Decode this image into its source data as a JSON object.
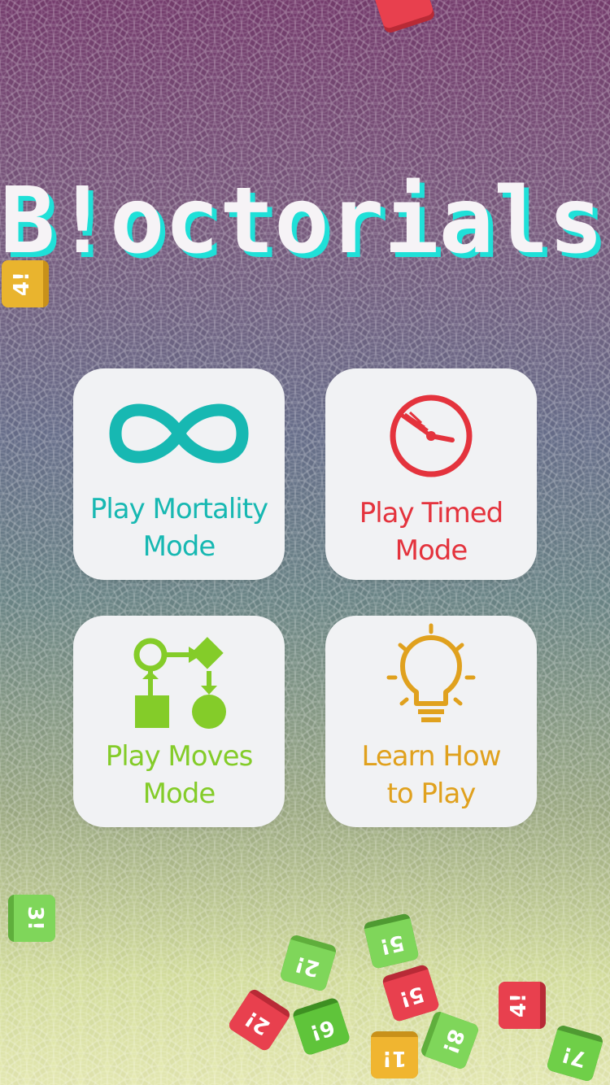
{
  "app": {
    "title": "B!octorials"
  },
  "colors": {
    "title_fill": "#f6f3f6",
    "title_shadow": "#1fe0d8",
    "card_bg": "#f1f2f4",
    "mortality": "#17b8b2",
    "timed": "#e4333d",
    "moves": "#84cc29",
    "learn": "#e0a11e"
  },
  "menu": {
    "mortality": {
      "line1": "Play Mortality",
      "line2": "Mode",
      "icon": "infinity-icon"
    },
    "timed": {
      "line1": "Play Timed",
      "line2": "Mode",
      "icon": "stopwatch-icon"
    },
    "moves": {
      "line1": "Play Moves",
      "line2": "Mode",
      "icon": "flowchart-icon"
    },
    "learn": {
      "line1": "Learn How",
      "line2": "to Play",
      "icon": "lightbulb-icon"
    }
  },
  "blocks": [
    {
      "label": "4!",
      "color": "#e9b42e",
      "shade": "#c8911a"
    },
    {
      "label": "3!",
      "color": "#7fd65a",
      "shade": "#5fae3c"
    },
    {
      "label": "2!",
      "color": "#7fd65a",
      "shade": "#5fae3c"
    },
    {
      "label": "5!",
      "color": "#7fd65a",
      "shade": "#4f9a32"
    },
    {
      "label": "2!",
      "color": "#e8404e",
      "shade": "#b82a36"
    },
    {
      "label": "6!",
      "color": "#5fc43a",
      "shade": "#3e8f22"
    },
    {
      "label": "5!",
      "color": "#e8404e",
      "shade": "#b82a36"
    },
    {
      "label": "1!",
      "color": "#f0b530",
      "shade": "#c8911a"
    },
    {
      "label": "8!",
      "color": "#7fd65a",
      "shade": "#5fae3c"
    },
    {
      "label": "4!",
      "color": "#e8404e",
      "shade": "#b82a36"
    },
    {
      "label": "7!",
      "color": "#6fcf48",
      "shade": "#4f9a32"
    }
  ]
}
